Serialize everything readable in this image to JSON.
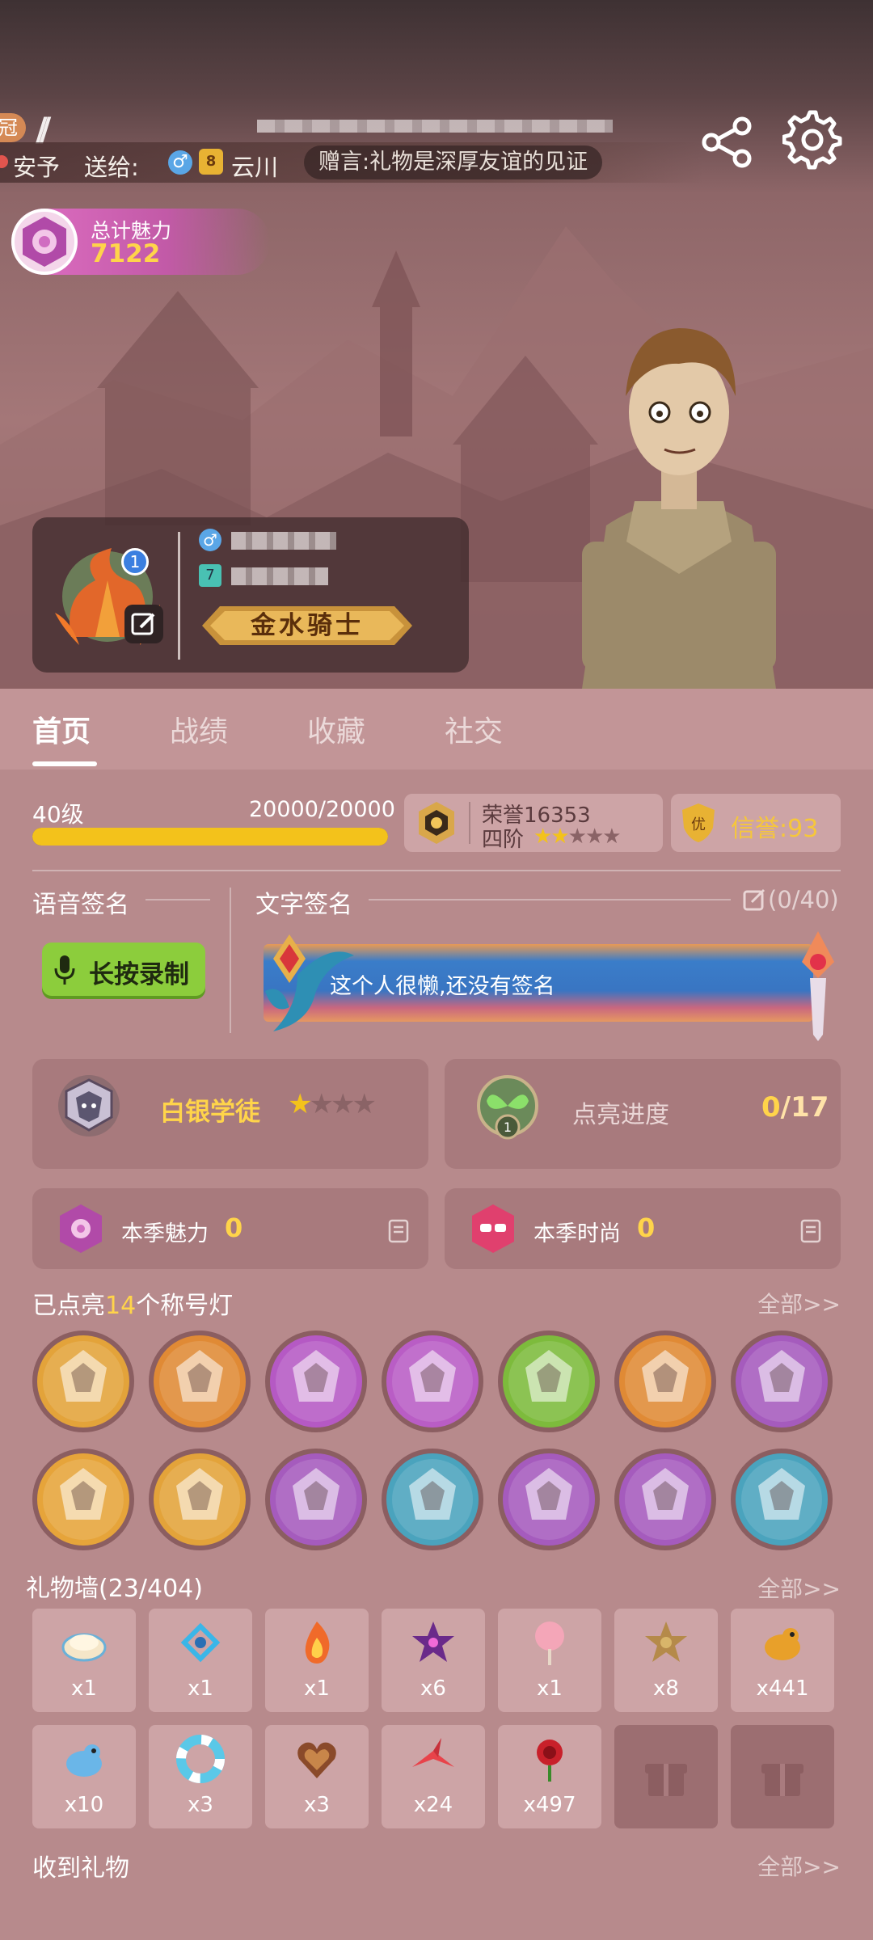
{
  "top_bar": {
    "badge_text": "冠",
    "gift_feed": {
      "sender": "安予",
      "send_label": "送给:",
      "receiver_level": "8",
      "receiver": "云川",
      "message": "赠言:礼物是深厚友谊的见证"
    }
  },
  "charm": {
    "label": "总计魅力",
    "value": "7122"
  },
  "profile": {
    "level_badge": "1",
    "id_tag": "7",
    "title": "金水骑士"
  },
  "tabs": [
    {
      "label": "首页",
      "active": true
    },
    {
      "label": "战绩",
      "active": false
    },
    {
      "label": "收藏",
      "active": false
    },
    {
      "label": "社交",
      "active": false
    }
  ],
  "level": {
    "label": "40级",
    "exp_text": "20000/20000",
    "progress": 1.0
  },
  "honor": {
    "label": "荣誉16353",
    "rank": "四阶",
    "stars_filled": 2,
    "stars_total": 5
  },
  "credit": {
    "label": "信誉:93",
    "badge": "优"
  },
  "voice_signature": {
    "label": "语音签名",
    "button": "长按录制"
  },
  "text_signature": {
    "label": "文字签名",
    "count": "(0/40)",
    "text": "这个人很懒,还没有签名"
  },
  "rank_card": {
    "name": "白银学徒",
    "stars_filled": 1,
    "stars_total": 4
  },
  "light_card": {
    "label": "点亮进度",
    "current": "0",
    "total": "/17"
  },
  "season_charm": {
    "label": "本季魅力",
    "value": "0"
  },
  "season_fashion": {
    "label": "本季时尚",
    "value": "0"
  },
  "title_lights": {
    "prefix": "已点亮",
    "count": "14",
    "suffix": "个称号灯",
    "more": "全部>>",
    "colors": [
      "#e3a33a",
      "#e08a35",
      "#b559c4",
      "#b95dc5",
      "#7dbb3c",
      "#e08a35",
      "#a55bbd",
      "#e6a43a",
      "#e3a33a",
      "#a55bbd",
      "#4aa3bd",
      "#a55bbd",
      "#a55bbd",
      "#4aa3bd"
    ]
  },
  "gift_wall": {
    "label": "礼物墙(23/404)",
    "more": "全部>>",
    "items": [
      {
        "icon": "dumpling-icon",
        "count": "x1"
      },
      {
        "icon": "blue-knot-icon",
        "count": "x1"
      },
      {
        "icon": "flame-icon",
        "count": "x1"
      },
      {
        "icon": "star-icon",
        "count": "x6"
      },
      {
        "icon": "cotton-candy-icon",
        "count": "x1"
      },
      {
        "icon": "sheriff-star-icon",
        "count": "x8"
      },
      {
        "icon": "golden-bird-icon",
        "count": "x441"
      },
      {
        "icon": "blue-bird-icon",
        "count": "x10"
      },
      {
        "icon": "life-ring-icon",
        "count": "x3"
      },
      {
        "icon": "chocolate-heart-icon",
        "count": "x3"
      },
      {
        "icon": "paper-crane-icon",
        "count": "x24"
      },
      {
        "icon": "rose-icon",
        "count": "x497"
      },
      {
        "icon": "gift-box-icon",
        "count": ""
      },
      {
        "icon": "gift-box-icon",
        "count": ""
      }
    ]
  },
  "received_gifts": {
    "label": "收到礼物",
    "more": "全部>>"
  }
}
